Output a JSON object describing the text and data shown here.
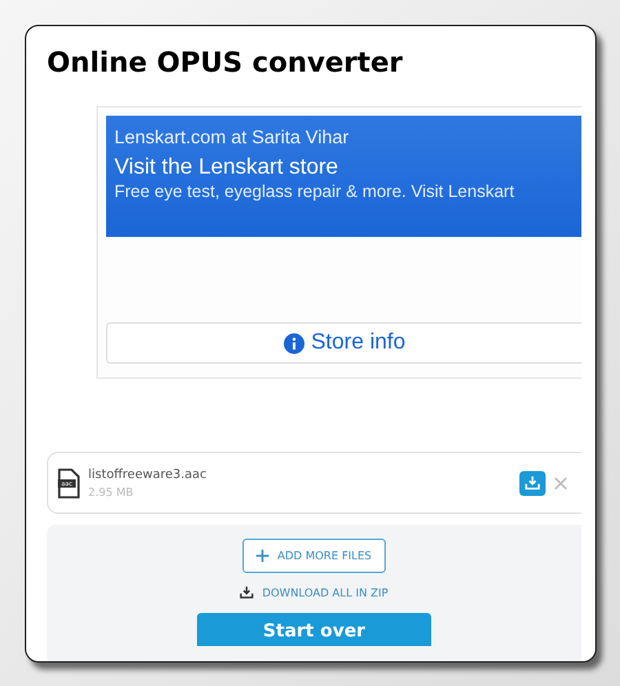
{
  "title": "Online OPUS converter",
  "ad": {
    "advertiser": "Lenskart.com at Sarita Vihar",
    "headline": "Visit the Lenskart store",
    "description": "Free eye test, eyeglass repair & more. Visit Lenskart",
    "store_button": "Store info"
  },
  "files": [
    {
      "name": "listoffreeware3.aac",
      "type_label": "aac",
      "size": "2.95 MB"
    }
  ],
  "actions": {
    "add_more": "ADD MORE FILES",
    "download_all": "DOWNLOAD ALL IN ZIP",
    "start_over": "Start over"
  }
}
